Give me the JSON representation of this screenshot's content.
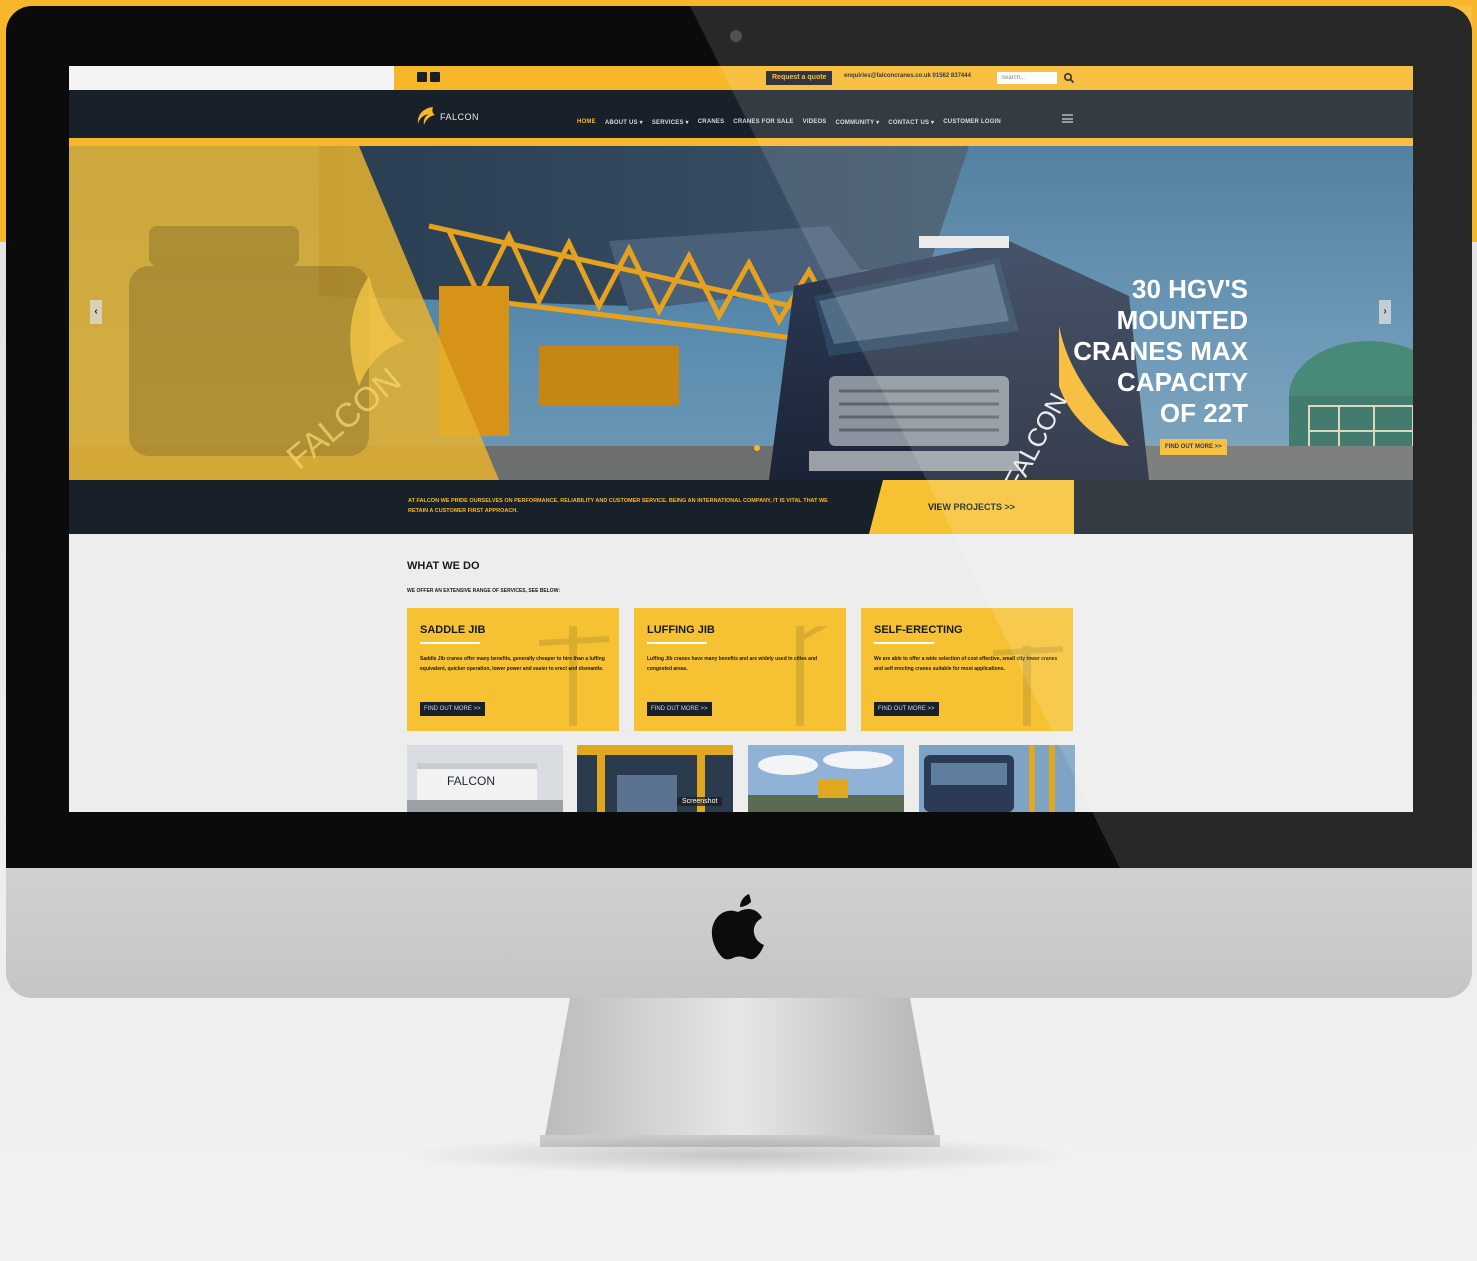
{
  "colors": {
    "accent": "#f6b82a",
    "navy": "#182029",
    "card": "#f6c234",
    "background": "#ededed"
  },
  "topbar": {
    "request_quote": "Request a quote",
    "email": "enquiries@falconcranes.co.uk  01562 837444",
    "search_placeholder": "Search..."
  },
  "logo": {
    "text": "FALCON"
  },
  "nav": {
    "items": [
      "HOME",
      "ABOUT US ▾",
      "SERVICES ▾",
      "CRANES",
      "CRANES FOR SALE",
      "VIDEOS",
      "COMMUNITY ▾",
      "CONTACT US ▾",
      "CUSTOMER LOGIN"
    ],
    "active_index": 0
  },
  "hero": {
    "title_lines": [
      "30 HGV'S",
      "MOUNTED",
      "CRANES MAX",
      "CAPACITY",
      "OF 22T"
    ],
    "button": "FIND OUT MORE >>",
    "truck_brand": "FALCON"
  },
  "strip": {
    "text": "AT FALCON WE PRIDE OURSELVES ON PERFORMANCE, RELIABILITY AND CUSTOMER SERVICE. BEING AN INTERNATIONAL COMPANY, IT IS VITAL THAT WE RETAIN A CUSTOMER FIRST APPROACH.",
    "projects_button": "VIEW PROJECTS >>"
  },
  "what_we_do": {
    "title": "WHAT WE DO",
    "subtitle": "WE OFFER AN EXTENSIVE RANGE OF SERVICES, SEE BELOW:",
    "cards": [
      {
        "title": "SADDLE JIB",
        "text": "Saddle Jib cranes offer many benefits, generally cheaper to hire than a luffing equivalent, quicker operation, lower power and easier to erect and dismantle.",
        "button": "FIND OUT MORE >>"
      },
      {
        "title": "LUFFING JIB",
        "text": "Luffing Jib cranes have many benefits and are widely used in cities and congested areas.",
        "button": "FIND OUT MORE >>"
      },
      {
        "title": "SELF-ERECTING",
        "text": "We are able to offer a wide selection of cost effective, small city tower cranes and self erecting cranes suitable for most applications.",
        "button": "FIND OUT MORE >>"
      }
    ]
  },
  "thumbnails": {
    "label": "Screenshot",
    "thumb1_brand": "FALCON"
  }
}
